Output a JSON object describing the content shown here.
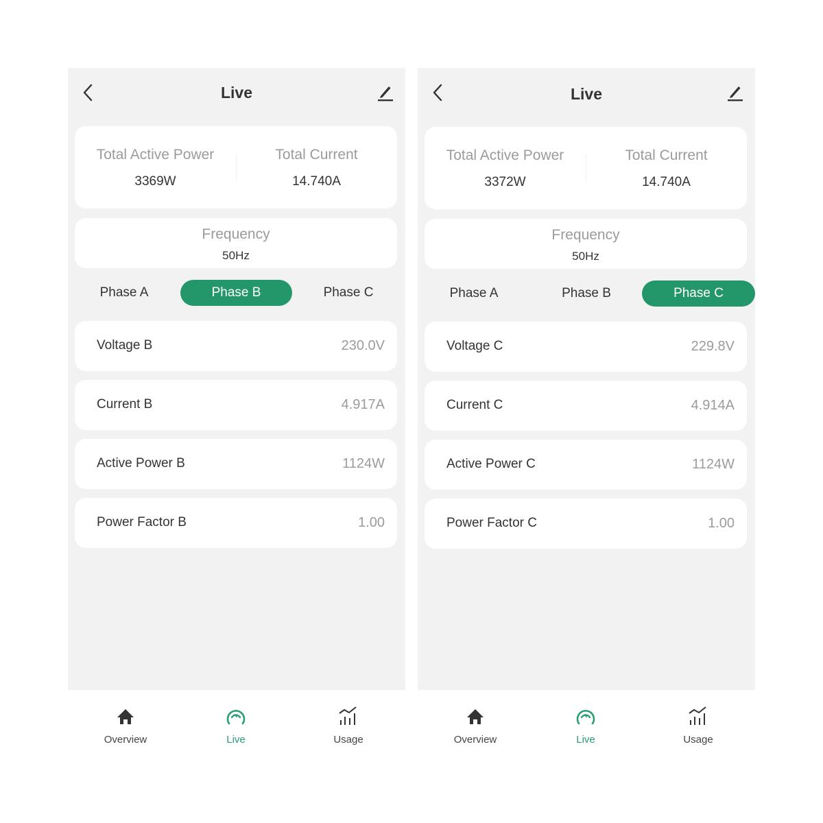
{
  "colors": {
    "accent": "#23976a",
    "background": "#f2f2f2",
    "card": "#ffffff",
    "label": "#9b9b9b",
    "text": "#333333"
  },
  "screens": [
    {
      "header": {
        "title": "Live",
        "back_icon": "chevron-left-icon",
        "edit_icon": "pencil-icon"
      },
      "totals": {
        "active_power_label": "Total Active Power",
        "active_power_value": "3369W",
        "current_label": "Total Current",
        "current_value": "14.740A"
      },
      "frequency": {
        "label": "Frequency",
        "value": "50Hz"
      },
      "tabs": [
        {
          "label": "Phase A",
          "active": false
        },
        {
          "label": "Phase B",
          "active": true
        },
        {
          "label": "Phase C",
          "active": false
        }
      ],
      "rows": [
        {
          "name": "Voltage B",
          "value": "230.0V"
        },
        {
          "name": "Current B",
          "value": "4.917A"
        },
        {
          "name": "Active Power B",
          "value": "1124W"
        },
        {
          "name": "Power Factor B",
          "value": "1.00"
        }
      ],
      "nav": [
        {
          "label": "Overview",
          "icon": "home-icon",
          "active": false
        },
        {
          "label": "Live",
          "icon": "gauge-icon",
          "active": true
        },
        {
          "label": "Usage",
          "icon": "chart-icon",
          "active": false
        }
      ]
    },
    {
      "header": {
        "title": "Live",
        "back_icon": "chevron-left-icon",
        "edit_icon": "pencil-icon"
      },
      "totals": {
        "active_power_label": "Total Active Power",
        "active_power_value": "3372W",
        "current_label": "Total Current",
        "current_value": "14.740A"
      },
      "frequency": {
        "label": "Frequency",
        "value": "50Hz"
      },
      "tabs": [
        {
          "label": "Phase A",
          "active": false
        },
        {
          "label": "Phase B",
          "active": false
        },
        {
          "label": "Phase C",
          "active": true
        }
      ],
      "rows": [
        {
          "name": "Voltage C",
          "value": "229.8V"
        },
        {
          "name": "Current C",
          "value": "4.914A"
        },
        {
          "name": "Active Power C",
          "value": "1124W"
        },
        {
          "name": "Power Factor C",
          "value": "1.00"
        }
      ],
      "nav": [
        {
          "label": "Overview",
          "icon": "home-icon",
          "active": false
        },
        {
          "label": "Live",
          "icon": "gauge-icon",
          "active": true
        },
        {
          "label": "Usage",
          "icon": "chart-icon",
          "active": false
        }
      ]
    }
  ]
}
